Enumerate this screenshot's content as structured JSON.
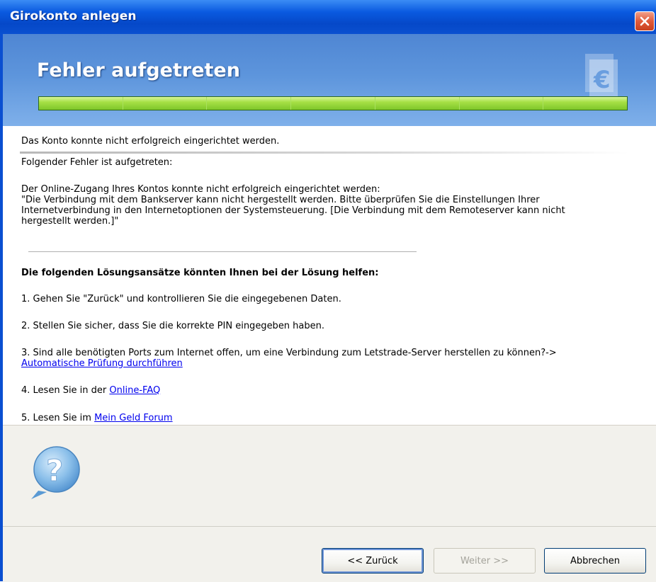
{
  "window": {
    "title": "Girokonto anlegen"
  },
  "header": {
    "title": "Fehler aufgetreten",
    "progress_segments": 7,
    "progress_filled": 7
  },
  "content": {
    "status_line": "Das Konto konnte nicht erfolgreich eingerichtet werden.",
    "error_label": "Folgender Fehler ist aufgetreten:",
    "error_line1": "Der Online-Zugang Ihres Kontos konnte nicht erfolgreich eingerichtet werden:",
    "error_line2": "\"Die Verbindung mit dem Bankserver kann nicht hergestellt werden. Bitte überprüfen Sie die Einstellungen Ihrer",
    "error_line3": "Internetverbindung in den Internetoptionen der Systemsteuerung. [Die Verbindung mit dem Remoteserver kann nicht",
    "error_line4": "hergestellt werden.]\"",
    "solutions_heading": "Die folgenden Lösungsansätze könnten Ihnen bei der Lösung helfen:",
    "solution1": "1. Gehen Sie \"Zurück\" und kontrollieren Sie die eingegebenen Daten.",
    "solution2": "2. Stellen Sie sicher, dass Sie die korrekte PIN eingegeben haben.",
    "solution3": "3. Sind alle benötigten Ports zum Internet offen, um eine Verbindung zum Letstrade-Server herstellen zu können?->",
    "solution3_link": "Automatische Prüfung durchführen",
    "solution4_prefix": "4. Lesen Sie in der ",
    "solution4_link": "Online-FAQ",
    "solution5_prefix": "5. Lesen Sie im ",
    "solution5_link": "Mein Geld Forum"
  },
  "buttons": {
    "back": "<< Zurück",
    "next": "Weiter >>",
    "cancel": "Abbrechen"
  },
  "icons": {
    "close": "close-icon",
    "logo": "euro-document-icon",
    "help": "question-bubble-icon"
  },
  "colors": {
    "titlebar": "#0548c8",
    "header": "#5d95dc",
    "progress": "#a6e045",
    "link": "#0000ee",
    "close": "#e05a3a"
  }
}
